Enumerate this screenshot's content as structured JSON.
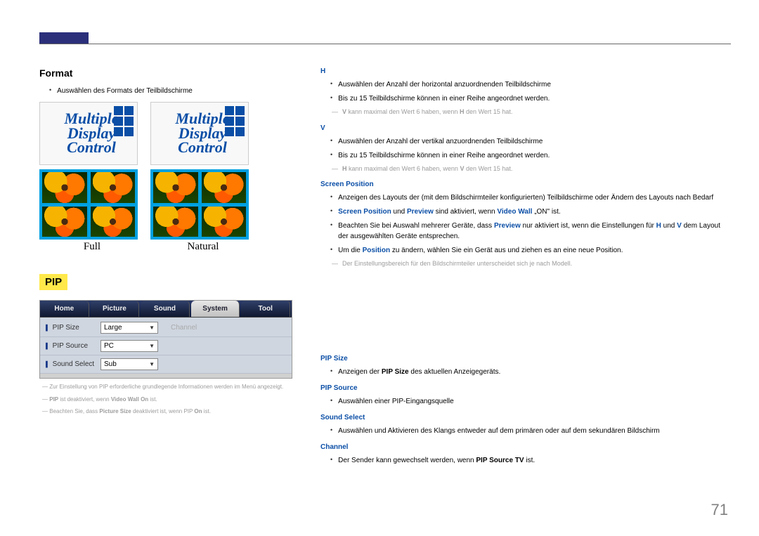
{
  "page_number": "71",
  "left": {
    "format_heading": "Format",
    "format_bullet": "Auswählen des Formats der Teilbildschirme",
    "mdc1": "Multiple",
    "mdc2": "Display",
    "mdc3": "Control",
    "full_label": "Full",
    "natural_label": "Natural",
    "pip_label": "PIP",
    "panel": {
      "tabs": [
        "Home",
        "Picture",
        "Sound",
        "System",
        "Tool"
      ],
      "rows": [
        {
          "label": "PIP Size",
          "value": "Large",
          "extra": "Channel"
        },
        {
          "label": "PIP Source",
          "value": "PC"
        },
        {
          "label": "Sound Select",
          "value": "Sub"
        }
      ]
    },
    "notes": {
      "n1a": "Zur Einstellung von PIP erforderliche grundlegende Informationen werden im Menü angezeigt.",
      "n2_pre": "PIP",
      "n2_mid": " ist deaktiviert, wenn ",
      "n2_b": "Video Wall On",
      "n2_post": " ist.",
      "n3_pre": "Beachten Sie, dass ",
      "n3_b": "Picture Size",
      "n3_mid": " deaktiviert ist, wenn PIP ",
      "n3_b2": "On",
      "n3_post": " ist."
    }
  },
  "right": {
    "h": {
      "head": "H",
      "b1": "Auswählen der Anzahl der horizontal anzuordnenden Teilbildschirme",
      "b2": "Bis zu 15 Teilbildschirme können in einer Reihe angeordnet werden.",
      "note_pre": "",
      "note_bV": "V",
      "note_mid": " kann maximal den Wert 6 haben, wenn ",
      "note_bH": "H",
      "note_post": " den Wert 15 hat."
    },
    "v": {
      "head": "V",
      "b1": "Auswählen der Anzahl der vertikal anzuordnenden Teilbildschirme",
      "b2": "Bis zu 15 Teilbildschirme können in einer Reihe angeordnet werden.",
      "note_bH": "H",
      "note_mid": " kann maximal den Wert 6 haben, wenn ",
      "note_bV": "V",
      "note_post": " den Wert 15 hat."
    },
    "sp": {
      "head": "Screen Position",
      "b1": "Anzeigen des Layouts der (mit dem Bildschirmteiler konfigurierten) Teilbildschirme oder Ändern des Layouts nach Bedarf",
      "b2_sp": "Screen Position",
      "b2_mid1": " und ",
      "b2_prev": "Preview",
      "b2_mid2": " sind aktiviert, wenn ",
      "b2_vw": "Video Wall",
      "b2_post": " „ON\" ist.",
      "b3_pre": "Beachten Sie bei Auswahl mehrerer Geräte, dass ",
      "b3_prev": "Preview",
      "b3_mid": " nur aktiviert ist, wenn die Einstellungen für ",
      "b3_H": "H",
      "b3_and": " und ",
      "b3_V": "V",
      "b3_post": " dem Layout der ausgewählten Geräte entsprechen.",
      "b4_pre": "Um die ",
      "b4_pos": "Position",
      "b4_post": " zu ändern, wählen Sie ein Gerät aus und ziehen es an eine neue Position.",
      "note": "Der Einstellungsbereich für den Bildschirmteiler unterscheidet sich je nach Modell."
    },
    "pipsize": {
      "head": "PIP Size",
      "pre": "Anzeigen der ",
      "b": "PIP Size",
      "post": " des aktuellen Anzeigegeräts."
    },
    "pipsource": {
      "head": "PIP Source",
      "b1": "Auswählen einer PIP-Eingangsquelle"
    },
    "sound": {
      "head": "Sound Select",
      "b1": "Auswählen und Aktivieren des Klangs entweder auf dem primären oder auf dem sekundären Bildschirm"
    },
    "channel": {
      "head": "Channel",
      "pre": "Der Sender kann gewechselt werden, wenn ",
      "b": "PIP Source TV",
      "post": " ist."
    }
  }
}
